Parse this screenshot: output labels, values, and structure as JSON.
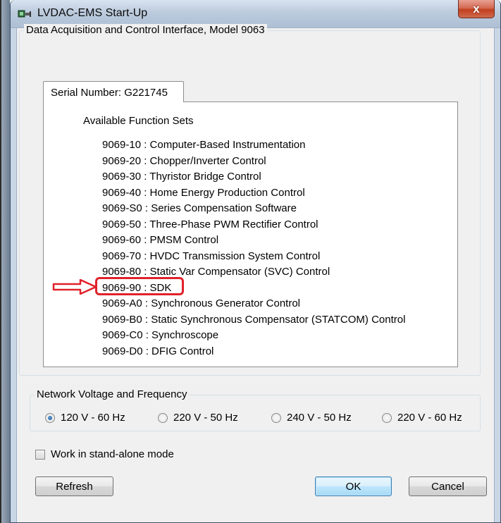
{
  "window": {
    "title": "LVDAC-EMS Start-Up",
    "close_glyph": "x"
  },
  "interface_group": {
    "label": "Data Acquisition and Control Interface, Model 9063",
    "tab_label": "Serial Number: G221745",
    "function_sets_heading": "Available Function Sets",
    "function_sets": [
      "9069-10 : Computer-Based Instrumentation",
      "9069-20 : Chopper/Inverter Control",
      "9069-30 : Thyristor Bridge Control",
      "9069-40 : Home Energy Production Control",
      "9069-S0 : Series Compensation Software",
      "9069-50 : Three-Phase PWM Rectifier Control",
      "9069-60 : PMSM Control",
      "9069-70 : HVDC Transmission System Control",
      "9069-80 : Static Var Compensator (SVC) Control",
      "9069-90 : SDK",
      "9069-A0 : Synchronous Generator Control",
      "9069-B0 : Static Synchronous Compensator (STATCOM) Control",
      "9069-C0 : Synchroscope",
      "9069-D0 : DFIG Control"
    ],
    "highlighted_index": 9
  },
  "network_group": {
    "label": "Network Voltage and Frequency",
    "options": [
      {
        "label": "120 V - 60 Hz",
        "checked": true
      },
      {
        "label": "220 V - 50 Hz",
        "checked": false
      },
      {
        "label": "240 V - 50 Hz",
        "checked": false
      },
      {
        "label": "220 V - 60 Hz",
        "checked": false
      }
    ]
  },
  "standalone": {
    "label": "Work in stand-alone mode",
    "checked": false
  },
  "buttons": {
    "refresh": "Refresh",
    "ok": "OK",
    "cancel": "Cancel"
  },
  "colors": {
    "annotation_red": "#e0222a",
    "title_bar": "#bccbdd",
    "close_button": "#c2401f"
  },
  "icons": {
    "app": "network-plug-icon",
    "close": "close-icon",
    "annotation": "red-arrow-icon"
  }
}
